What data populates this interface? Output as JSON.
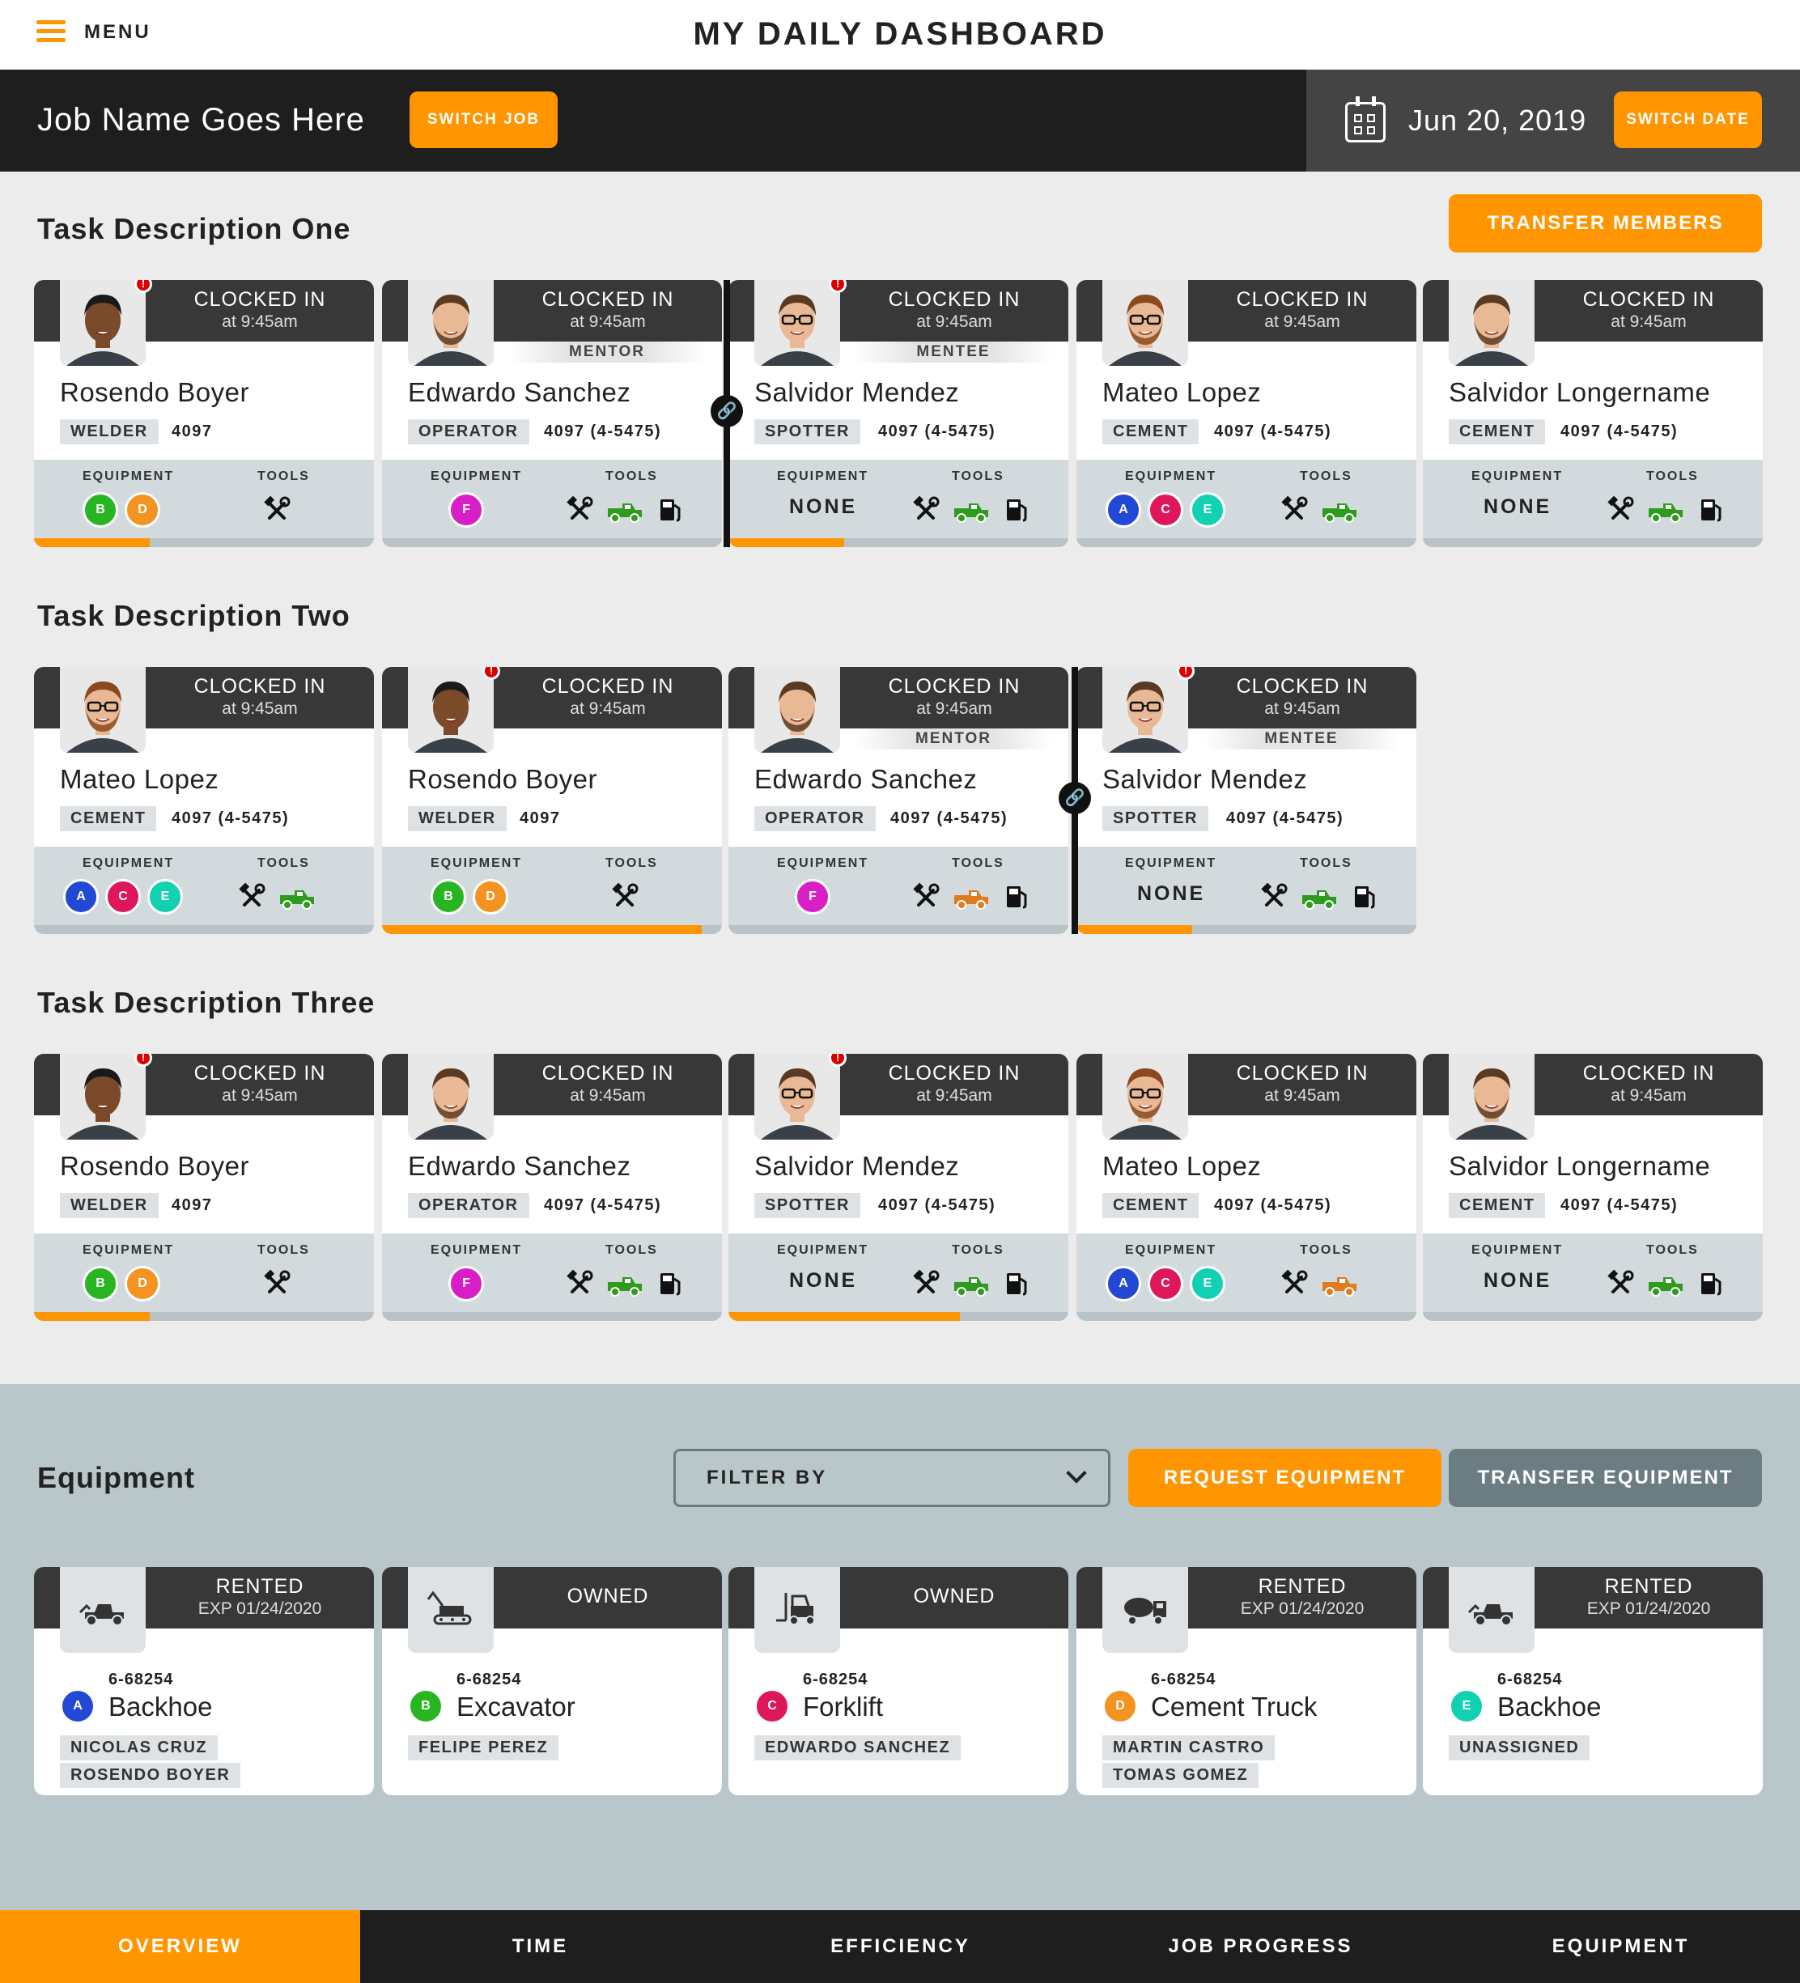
{
  "header": {
    "menu_label": "MENU",
    "title": "MY DAILY DASHBOARD"
  },
  "jobbar": {
    "job_name": "Job Name Goes Here",
    "switch_job": "SWITCH JOB",
    "date": "Jun 20, 2019",
    "switch_date": "SWITCH DATE"
  },
  "transfer_members": "TRANSFER MEMBERS",
  "labels": {
    "equipment": "EQUIPMENT",
    "tools": "TOOLS",
    "none": "NONE"
  },
  "colors": {
    "accent": "#ff9500",
    "dark": "#383838",
    "tool_green": "#2e9a1e",
    "tool_orange": "#e07b1e",
    "A": "#2249d6",
    "B": "#27b522",
    "C": "#e0165a",
    "D": "#f39321",
    "E": "#12d1b3",
    "F": "#d81fc7"
  },
  "tasks": [
    {
      "title": "Task Description One",
      "cards": [
        {
          "status": "CLOCKED IN",
          "time": "at 9:45am",
          "name": "Rosendo Boyer",
          "trade": "WELDER",
          "number": "4097",
          "equipment": [
            "B",
            "D"
          ],
          "tools": [
            "tools-icon"
          ],
          "progress": 0.34,
          "alert": true
        },
        {
          "status": "CLOCKED IN",
          "time": "at 9:45am",
          "role": "MENTOR",
          "name": "Edwardo Sanchez",
          "trade": "OPERATOR",
          "number": "4097 (4-5475)",
          "equipment": [
            "F"
          ],
          "tools": [
            "tools-icon",
            "truck-icon-green",
            "fuel-icon"
          ],
          "progress": 0
        },
        {
          "status": "CLOCKED IN",
          "time": "at 9:45am",
          "role": "MENTEE",
          "name": "Salvidor Mendez",
          "trade": "SPOTTER",
          "number": "4097 (4-5475)",
          "equipment": [],
          "tools": [
            "tools-icon",
            "truck-icon-green",
            "fuel-icon"
          ],
          "progress": 0.34,
          "alert": true
        },
        {
          "status": "CLOCKED IN",
          "time": "at 9:45am",
          "name": "Mateo Lopez",
          "trade": "CEMENT",
          "number": "4097 (4-5475)",
          "equipment": [
            "A",
            "C",
            "E"
          ],
          "tools": [
            "tools-icon",
            "truck-icon-green"
          ],
          "progress": 0
        },
        {
          "status": "CLOCKED IN",
          "time": "at 9:45am",
          "name": "Salvidor Longername",
          "trade": "CEMENT",
          "number": "4097 (4-5475)",
          "equipment": [],
          "tools": [
            "tools-icon",
            "truck-icon-green",
            "fuel-icon"
          ],
          "progress": 0
        }
      ]
    },
    {
      "title": "Task Description Two",
      "cards": [
        {
          "status": "CLOCKED IN",
          "time": "at 9:45am",
          "name": "Mateo Lopez",
          "trade": "CEMENT",
          "number": "4097 (4-5475)",
          "equipment": [
            "A",
            "C",
            "E"
          ],
          "tools": [
            "tools-icon",
            "truck-icon-green"
          ],
          "progress": 0
        },
        {
          "status": "CLOCKED IN",
          "time": "at 9:45am",
          "name": "Rosendo Boyer",
          "trade": "WELDER",
          "number": "4097",
          "equipment": [
            "B",
            "D"
          ],
          "tools": [
            "tools-icon"
          ],
          "progress": 0.94,
          "alert": true
        },
        {
          "status": "CLOCKED IN",
          "time": "at 9:45am",
          "role": "MENTOR",
          "name": "Edwardo Sanchez",
          "trade": "OPERATOR",
          "number": "4097 (4-5475)",
          "equipment": [
            "F"
          ],
          "tools": [
            "tools-icon",
            "truck-icon-orange",
            "fuel-icon"
          ],
          "progress": 0
        },
        {
          "status": "CLOCKED IN",
          "time": "at 9:45am",
          "role": "MENTEE",
          "name": "Salvidor Mendez",
          "trade": "SPOTTER",
          "number": "4097 (4-5475)",
          "equipment": [],
          "tools": [
            "tools-icon",
            "truck-icon-green",
            "fuel-icon"
          ],
          "progress": 0.34,
          "alert": true
        }
      ]
    },
    {
      "title": "Task Description Three",
      "cards": [
        {
          "status": "CLOCKED IN",
          "time": "at 9:45am",
          "name": "Rosendo Boyer",
          "trade": "WELDER",
          "number": "4097",
          "equipment": [
            "B",
            "D"
          ],
          "tools": [
            "tools-icon"
          ],
          "progress": 0.34,
          "alert": true
        },
        {
          "status": "CLOCKED IN",
          "time": "at 9:45am",
          "name": "Edwardo Sanchez",
          "trade": "OPERATOR",
          "number": "4097 (4-5475)",
          "equipment": [
            "F"
          ],
          "tools": [
            "tools-icon",
            "truck-icon-green",
            "fuel-icon"
          ],
          "progress": 0
        },
        {
          "status": "CLOCKED IN",
          "time": "at 9:45am",
          "name": "Salvidor Mendez",
          "trade": "SPOTTER",
          "number": "4097 (4-5475)",
          "equipment": [],
          "tools": [
            "tools-icon",
            "truck-icon-green",
            "fuel-icon"
          ],
          "progress": 0.68,
          "alert": true
        },
        {
          "status": "CLOCKED IN",
          "time": "at 9:45am",
          "name": "Mateo Lopez",
          "trade": "CEMENT",
          "number": "4097 (4-5475)",
          "equipment": [
            "A",
            "C",
            "E"
          ],
          "tools": [
            "tools-icon",
            "truck-icon-orange"
          ],
          "progress": 0
        },
        {
          "status": "CLOCKED IN",
          "time": "at 9:45am",
          "name": "Salvidor Longername",
          "trade": "CEMENT",
          "number": "4097 (4-5475)",
          "equipment": [],
          "tools": [
            "tools-icon",
            "truck-icon-green",
            "fuel-icon"
          ],
          "progress": 0
        }
      ]
    }
  ],
  "equipment_section": {
    "title": "Equipment",
    "filter_label": "FILTER BY",
    "request": "REQUEST EQUIPMENT",
    "transfer": "TRANSFER EQUIPMENT",
    "items": [
      {
        "ownership": "RENTED",
        "expiry": "EXP 01/24/2020",
        "letter": "A",
        "id": "6-68254",
        "name": "Backhoe",
        "icon": "backhoe-icon",
        "assignees": [
          "NICOLAS CRUZ",
          "ROSENDO BOYER"
        ]
      },
      {
        "ownership": "OWNED",
        "letter": "B",
        "id": "6-68254",
        "name": "Excavator",
        "icon": "excavator-icon",
        "assignees": [
          "FELIPE PEREZ"
        ]
      },
      {
        "ownership": "OWNED",
        "letter": "C",
        "id": "6-68254",
        "name": "Forklift",
        "icon": "forklift-icon",
        "assignees": [
          "EDWARDO SANCHEZ"
        ]
      },
      {
        "ownership": "RENTED",
        "expiry": "EXP 01/24/2020",
        "letter": "D",
        "id": "6-68254",
        "name": "Cement Truck",
        "icon": "cement-truck-icon",
        "assignees": [
          "MARTIN CASTRO",
          "TOMAS GOMEZ"
        ]
      },
      {
        "ownership": "RENTED",
        "expiry": "EXP 01/24/2020",
        "letter": "E",
        "id": "6-68254",
        "name": "Backhoe",
        "icon": "backhoe-icon",
        "assignees": [
          "UNASSIGNED"
        ]
      }
    ]
  },
  "bottom_nav": [
    {
      "label": "OVERVIEW",
      "active": true
    },
    {
      "label": "TIME"
    },
    {
      "label": "EFFICIENCY"
    },
    {
      "label": "JOB PROGRESS"
    },
    {
      "label": "EQUIPMENT"
    }
  ]
}
